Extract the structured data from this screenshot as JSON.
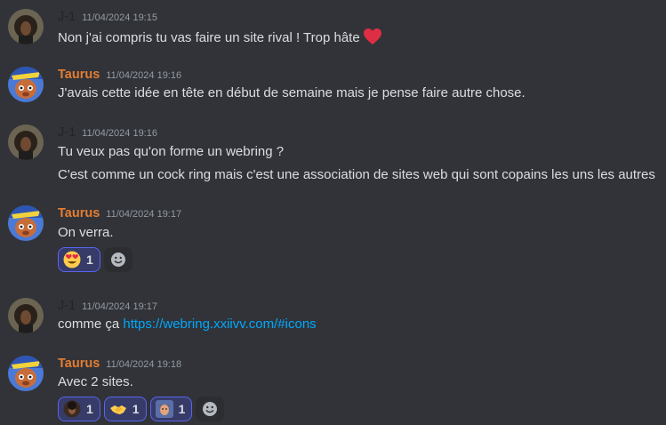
{
  "messages": [
    {
      "author": "J-1",
      "timestamp": "11/04/2024 19:15",
      "lines": [
        "Non j'ai compris tu vas faire un site rival ! Trop hâte"
      ],
      "emoji": "heart"
    },
    {
      "author": "Taurus",
      "timestamp": "11/04/2024 19:16",
      "lines": [
        "J'avais cette idée en tête en début de semaine mais je pense faire autre chose."
      ]
    },
    {
      "author": "J-1",
      "timestamp": "11/04/2024 19:16",
      "lines": [
        "Tu veux pas qu'on forme un webring ?",
        "C'est comme un cock ring mais c'est une association de sites web qui sont copains les uns les autres"
      ]
    },
    {
      "author": "Taurus",
      "timestamp": "11/04/2024 19:17",
      "lines": [
        "On verra."
      ],
      "reactions": [
        {
          "emoji": "heart-eyes-emoji",
          "count": "1",
          "reacted": true
        }
      ]
    },
    {
      "author": "J-1",
      "timestamp": "11/04/2024 19:17",
      "text_prefix": "comme ça ",
      "link": "https://webring.xxiivv.com/#icons"
    },
    {
      "author": "Taurus",
      "timestamp": "11/04/2024 19:18",
      "lines": [
        "Avec 2 sites."
      ],
      "reactions": [
        {
          "emoji": "avatar-face-emoji",
          "count": "1",
          "reacted": true
        },
        {
          "emoji": "handshake-emoji",
          "count": "1",
          "reacted": true
        },
        {
          "emoji": "person-face-emoji",
          "count": "1",
          "reacted": true
        }
      ]
    }
  ],
  "colors": {
    "background": "#313338",
    "taurus": "#e47d32",
    "link": "#00a8fc",
    "reaction_active": "#5865f2"
  }
}
